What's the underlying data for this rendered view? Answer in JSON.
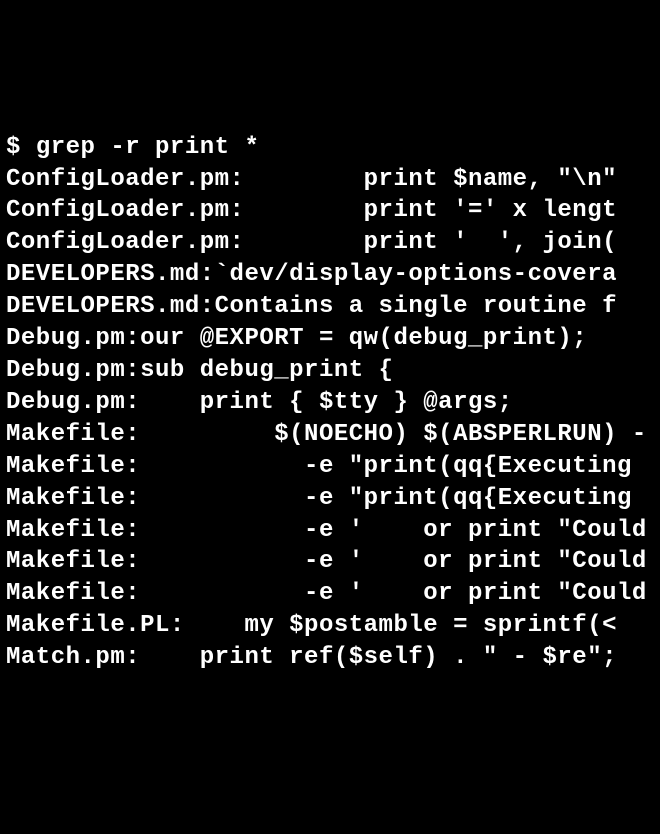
{
  "prompt": {
    "symbol": "$ ",
    "command": "grep -r print *"
  },
  "lines": [
    "ConfigLoader.pm:        print $name, \"\\n\"",
    "ConfigLoader.pm:        print '=' x lengt",
    "ConfigLoader.pm:        print '  ', join(",
    "DEVELOPERS.md:`dev/display-options-covera",
    "DEVELOPERS.md:Contains a single routine f",
    "Debug.pm:our @EXPORT = qw(debug_print);",
    "Debug.pm:sub debug_print {",
    "Debug.pm:    print { $tty } @args;",
    "Makefile:\t  $(NOECHO) $(ABSPERLRUN) -",
    "Makefile:\t    -e \"print(qq{Executing ",
    "Makefile:\t    -e \"print(qq{Executing ",
    "Makefile:\t    -e '    or print \"Could",
    "Makefile:\t    -e '    or print \"Could",
    "Makefile:\t    -e '    or print \"Could",
    "Makefile.PL:    my $postamble = sprintf(<",
    "Match.pm:    print ref($self) . \" - $re\";"
  ]
}
